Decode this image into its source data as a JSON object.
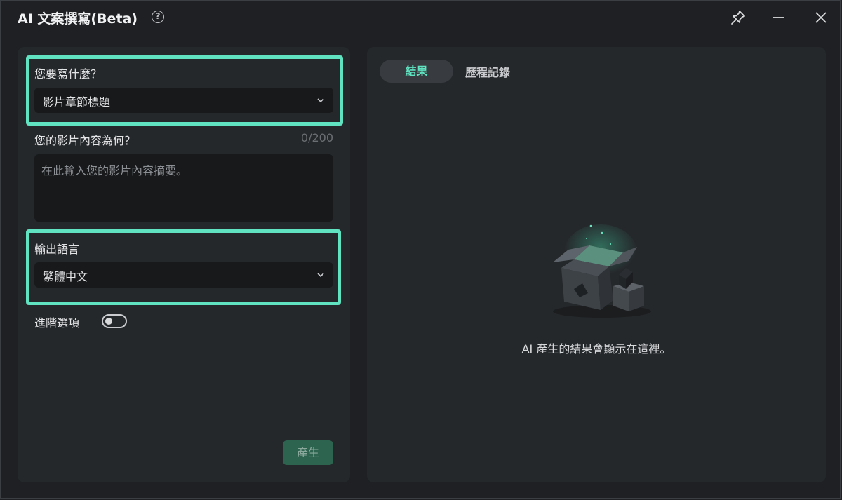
{
  "window": {
    "title": "AI 文案撰寫(Beta)",
    "help_icon": "?",
    "controls": {
      "pin": "pin-icon",
      "minimize": "minimize-icon",
      "close": "close-icon"
    }
  },
  "form": {
    "what_label": "您要寫什麼？",
    "what_value": "影片章節標題",
    "content_label": "您的影片內容為何？",
    "content_counter": "0/200",
    "content_placeholder": "在此輸入您的影片內容摘要。",
    "language_label": "輸出語言",
    "language_value": "繁體中文",
    "advanced_label": "進階選項",
    "advanced_enabled": false,
    "generate_label": "產生"
  },
  "results": {
    "tabs": [
      {
        "label": "結果",
        "active": true
      },
      {
        "label": "歷程記錄",
        "active": false
      }
    ],
    "empty_text": "AI 產生的結果會顯示在這裡。"
  },
  "colors": {
    "accent": "#5fe3c1",
    "highlight": "#5fe3c1",
    "background": "#1e2023",
    "panel": "#25282b",
    "generate_button": "#2d6450"
  }
}
